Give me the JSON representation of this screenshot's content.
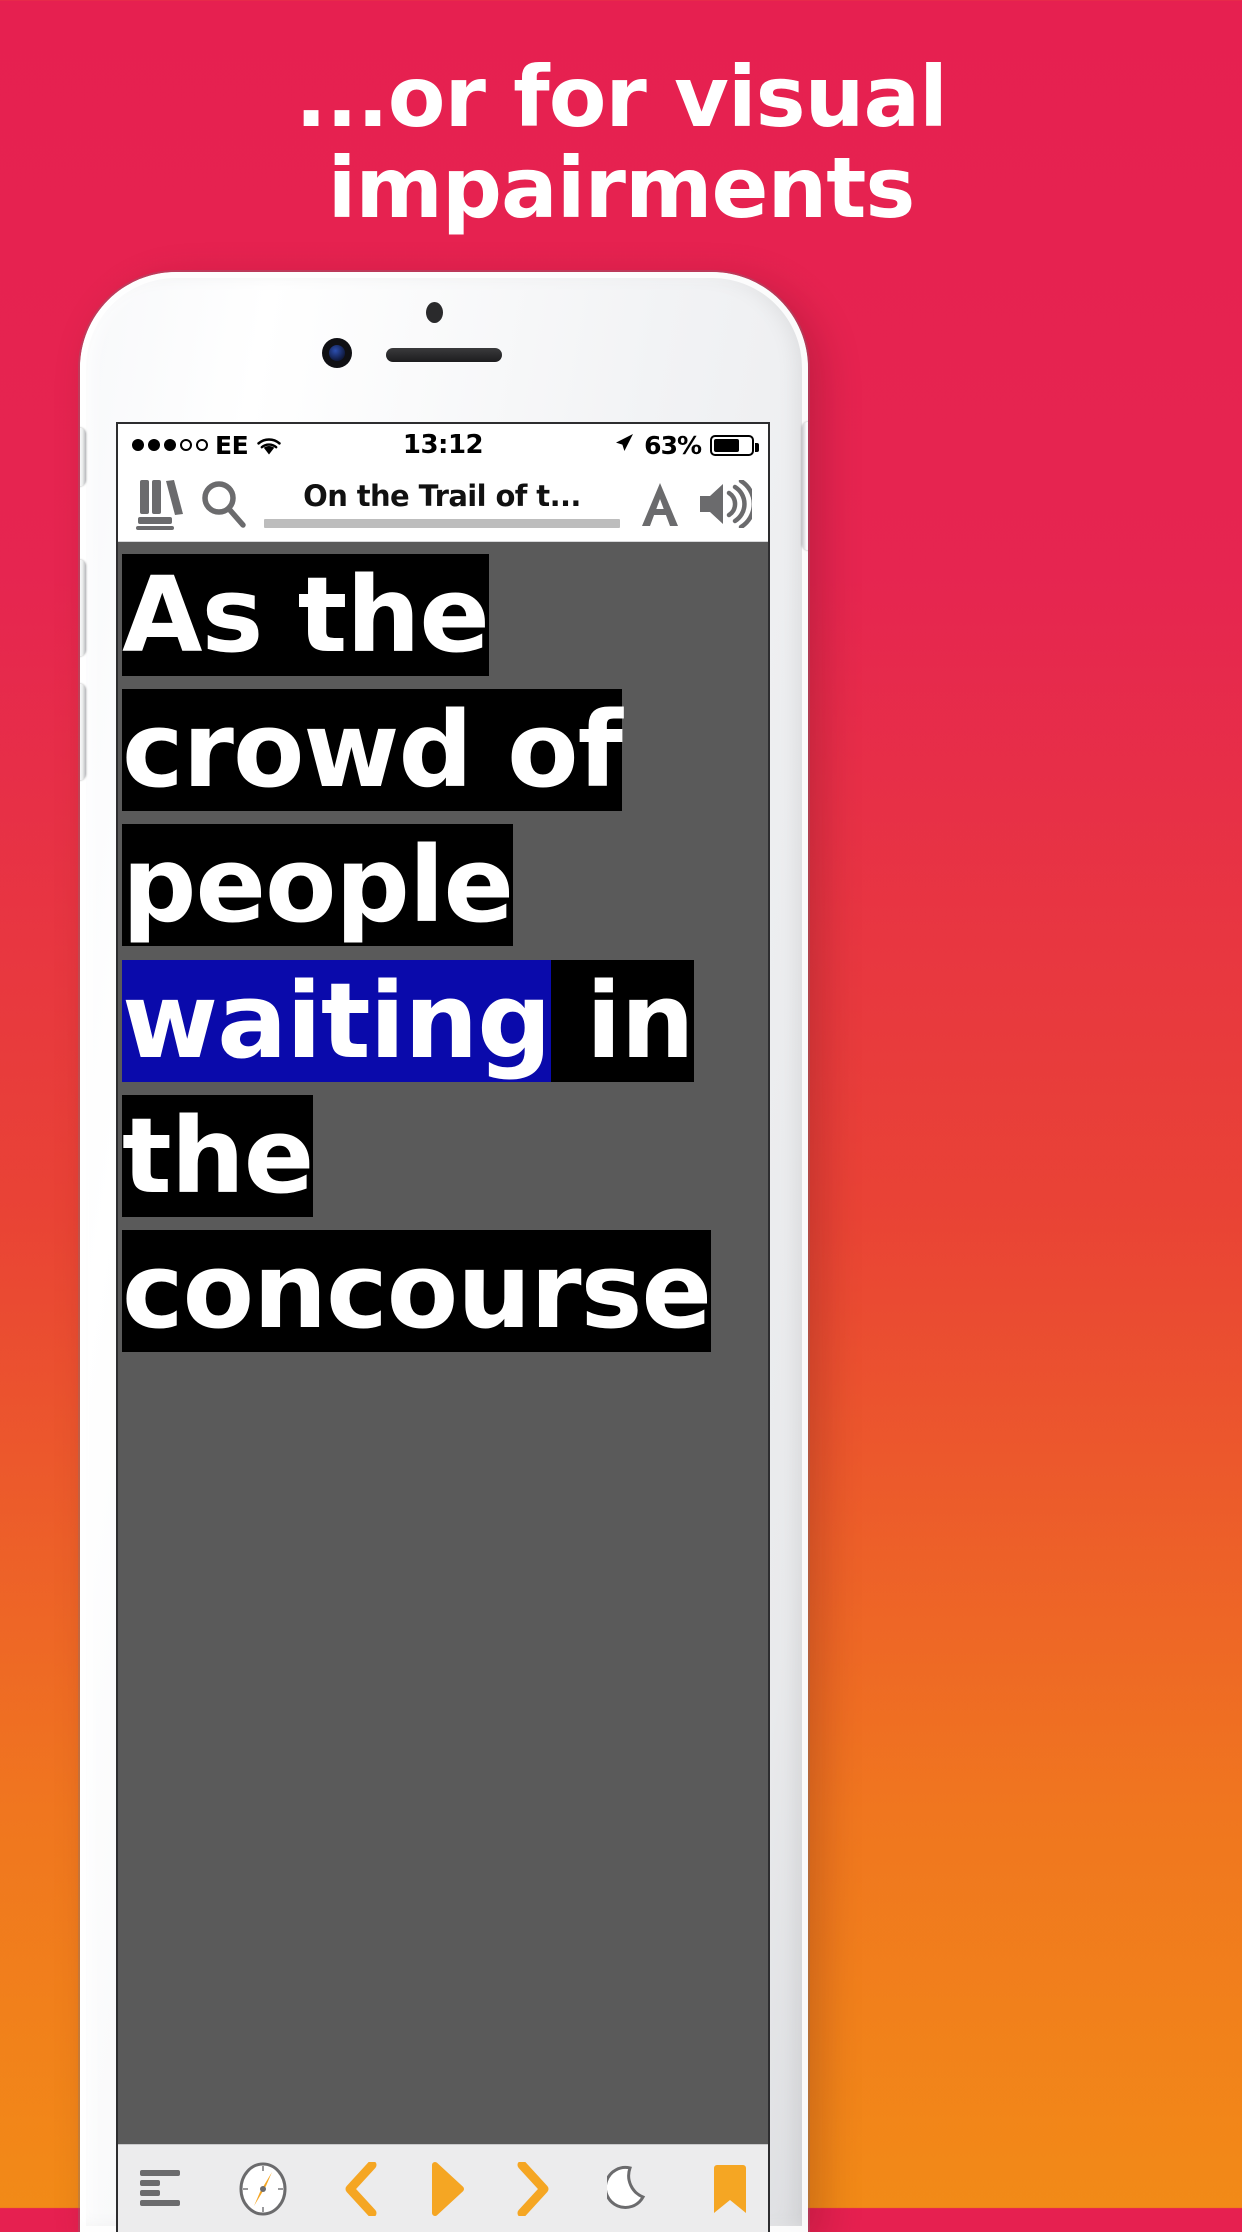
{
  "promo": {
    "headline_line1": "...or for visual",
    "headline_line2": "impairments",
    "background_top": "#E62050",
    "background_bottom": "#F28A17"
  },
  "device": {
    "type": "iphone-white",
    "buttons": [
      "mute-switch",
      "volume-up",
      "volume-down",
      "power"
    ]
  },
  "status_bar": {
    "signal_dots_filled": 3,
    "signal_dots_total": 5,
    "carrier": "EE",
    "wifi": "wifi-icon",
    "time": "13:12",
    "location_icon": "location-arrow-icon",
    "battery_percent": "63%",
    "battery_level": 63
  },
  "navbar": {
    "library_icon": "library-icon",
    "search_icon": "search-icon",
    "title": "On the Trail of t...",
    "progress_percent": 5,
    "font_size_icon": "font-size-A-icon",
    "speaker_icon": "speaker-icon"
  },
  "reader": {
    "page_background": "#5A5A5A",
    "highlight_background": "#000000",
    "highlight_text_color": "#FFFFFF",
    "spoken_word_background": "#0A0AAB",
    "lines": [
      {
        "text": "As the",
        "highlighted_word": null
      },
      {
        "text": "crowd of",
        "highlighted_word": null
      },
      {
        "text": "people",
        "highlighted_word": null
      },
      {
        "text": "waiting in",
        "highlighted_word": "waiting"
      },
      {
        "text": "the",
        "highlighted_word": null
      },
      {
        "text": "concourse",
        "highlighted_word": null
      }
    ]
  },
  "toolbar": {
    "contents_icon": "table-of-contents-icon",
    "navigate_icon": "compass-icon",
    "previous_icon": "previous-chevron-icon",
    "play_icon": "play-icon",
    "next_icon": "next-chevron-icon",
    "night_mode_icon": "moon-icon",
    "bookmark_icon": "bookmark-icon",
    "accent_color": "#F5A623"
  }
}
